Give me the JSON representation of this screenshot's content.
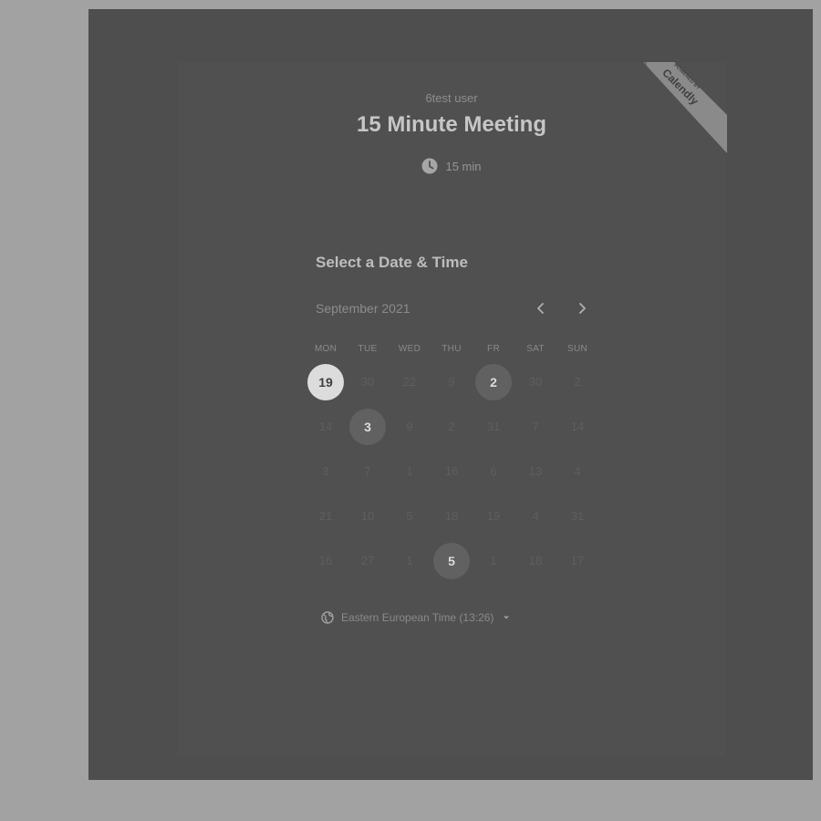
{
  "badge": {
    "line1": "POWERED BY",
    "line2": "Calendly"
  },
  "event": {
    "host": "6test user",
    "title": "15 Minute Meeting",
    "duration": "15 min"
  },
  "scheduler": {
    "heading": "Select a Date & Time",
    "month": "September 2021",
    "weekdays": [
      "MON",
      "TUE",
      "WED",
      "THU",
      "FR",
      "SAT",
      "SUN"
    ],
    "days": [
      {
        "label": "19",
        "state": "today"
      },
      {
        "label": "30",
        "state": "disabled"
      },
      {
        "label": "22",
        "state": "disabled"
      },
      {
        "label": "9",
        "state": "disabled"
      },
      {
        "label": "2",
        "state": "available"
      },
      {
        "label": "30",
        "state": "disabled"
      },
      {
        "label": "2",
        "state": "disabled"
      },
      {
        "label": "14",
        "state": "disabled"
      },
      {
        "label": "3",
        "state": "available"
      },
      {
        "label": "9",
        "state": "disabled"
      },
      {
        "label": "2",
        "state": "disabled"
      },
      {
        "label": "31",
        "state": "disabled"
      },
      {
        "label": "7",
        "state": "disabled"
      },
      {
        "label": "14",
        "state": "disabled"
      },
      {
        "label": "3",
        "state": "disabled"
      },
      {
        "label": "7",
        "state": "disabled"
      },
      {
        "label": "1",
        "state": "disabled"
      },
      {
        "label": "16",
        "state": "disabled"
      },
      {
        "label": "6",
        "state": "disabled"
      },
      {
        "label": "13",
        "state": "disabled"
      },
      {
        "label": "4",
        "state": "disabled"
      },
      {
        "label": "21",
        "state": "disabled"
      },
      {
        "label": "10",
        "state": "disabled"
      },
      {
        "label": "5",
        "state": "disabled"
      },
      {
        "label": "18",
        "state": "disabled"
      },
      {
        "label": "19",
        "state": "disabled"
      },
      {
        "label": "4",
        "state": "disabled"
      },
      {
        "label": "31",
        "state": "disabled"
      },
      {
        "label": "16",
        "state": "disabled"
      },
      {
        "label": "27",
        "state": "disabled"
      },
      {
        "label": "1",
        "state": "disabled"
      },
      {
        "label": "5",
        "state": "available"
      },
      {
        "label": "1",
        "state": "disabled"
      },
      {
        "label": "18",
        "state": "disabled"
      },
      {
        "label": "17",
        "state": "disabled"
      }
    ],
    "timezone": "Eastern European Time (13:26)"
  },
  "icons": {
    "clock": "clock-icon",
    "prev": "chevron-left-icon",
    "next": "chevron-right-icon",
    "globe": "globe-icon",
    "caret": "caret-down-icon"
  },
  "colors": {
    "page_background": "#a2a2a2",
    "frame": "#4e4e4e",
    "today_circle": "#dcdcdc",
    "available_circle": "#616161",
    "badge": "#8a8a8a"
  }
}
